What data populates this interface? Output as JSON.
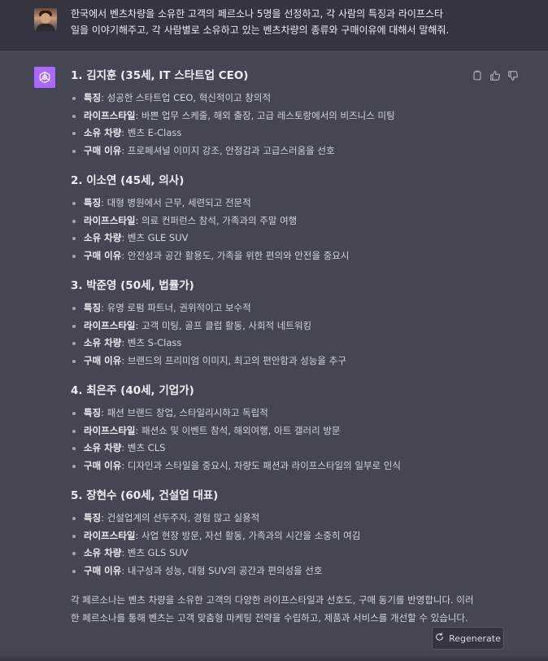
{
  "user": {
    "message": "한국에서 벤츠차량을 소유한 고객의 페르소나 5명을 선정하고, 각 사람의 특징과 라이프스타\n일을 이야기해주고, 각 사람별로 소유하고 있는 벤츠차량의 종류와 구매이유에 대해서 말해줘."
  },
  "labels": {
    "trait": "특징",
    "lifestyle": "라이프스타일",
    "car": "소유 차량",
    "reason": "구매 이유"
  },
  "personas": [
    {
      "title": "1. 김지훈 (35세, IT 스타트업 CEO)",
      "trait": ": 성공한 스타트업 CEO, 혁신적이고 창의적",
      "lifestyle": ": 바쁜 업무 스케줄, 해외 출장, 고급 레스토랑에서의 비즈니스 미팅",
      "car": ": 벤츠 E-Class",
      "reason": ": 프로페셔널 이미지 강조, 안정감과 고급스러움을 선호"
    },
    {
      "title": "2. 이소연 (45세, 의사)",
      "trait": ": 대형 병원에서 근무, 세련되고 전문적",
      "lifestyle": ": 의료 컨퍼런스 참석, 가족과의 주말 여행",
      "car": ": 벤츠 GLE SUV",
      "reason": ": 안전성과 공간 활용도, 가족을 위한 편의와 안전을 중요시"
    },
    {
      "title": "3. 박준영 (50세, 법률가)",
      "trait": ": 유명 로펌 파트너, 권위적이고 보수적",
      "lifestyle": ": 고객 미팅, 골프 클럽 활동, 사회적 네트워킹",
      "car": ": 벤츠 S-Class",
      "reason": ": 브랜드의 프리미엄 이미지, 최고의 편안함과 성능을 추구"
    },
    {
      "title": "4. 최은주 (40세, 기업가)",
      "trait": ": 패션 브랜드 창업, 스타일리시하고 독립적",
      "lifestyle": ": 패션쇼 및 이벤트 참석, 해외여행, 아트 갤러리 방문",
      "car": ": 벤츠 CLS",
      "reason": ": 디자인과 스타일을 중요시, 차량도 패션과 라이프스타일의 일부로 인식"
    },
    {
      "title": "5. 장현수 (60세, 건설업 대표)",
      "trait": ": 건설업계의 선두주자, 경험 많고 실용적",
      "lifestyle": ": 사업 현장 방문, 자선 활동, 가족과의 시간을 소중히 여김",
      "car": ": 벤츠 GLS SUV",
      "reason": ": 내구성과 성능, 대형 SUV의 공간과 편의성을 선호"
    }
  ],
  "summary": "각 페르소나는 벤츠 차량을 소유한 고객의 다양한 라이프스타일과 선호도, 구매 동기를 반영합니다. 이러한 페르소나를 통해 벤츠는 고객 맞춤형 마케팅 전략을 수립하고, 제품과 서비스를 개선할 수 있습니다.",
  "regenerate": {
    "label": "Regenerate",
    "icon": "refresh-icon"
  },
  "icons": [
    "copy-icon",
    "thumbs-up-icon",
    "thumbs-down-icon",
    "openai-logo-icon"
  ],
  "colors": {
    "bg_user": "#343541",
    "bg_ai": "#444654",
    "ai_avatar": "#ab68ff"
  }
}
